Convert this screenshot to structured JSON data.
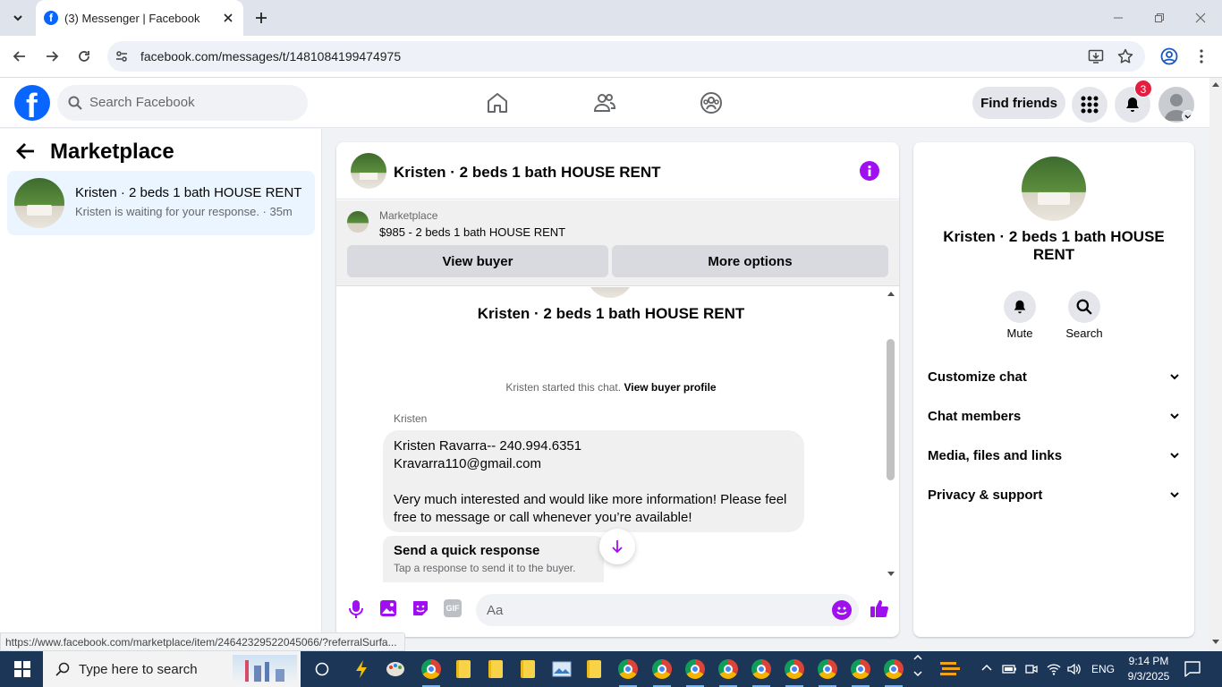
{
  "browser": {
    "tab_title": "(3) Messenger | Facebook",
    "url": "facebook.com/messages/t/1481084199474975"
  },
  "header": {
    "search_placeholder": "Search Facebook",
    "find_friends": "Find friends",
    "notification_count": "3",
    "accent": "#0866ff"
  },
  "left": {
    "title": "Marketplace",
    "conversation": {
      "name": "Kristen · 2 beds 1 bath HOUSE RENT",
      "preview": "Kristen is waiting for your response. · 35m"
    }
  },
  "chat": {
    "title": "Kristen · 2 beds 1 bath HOUSE RENT",
    "marketplace_label": "Marketplace",
    "listing": "$985 - 2 beds 1 bath HOUSE RENT",
    "view_buyer": "View buyer",
    "more_options": "More options",
    "intro_name": "Kristen · 2 beds 1 bath HOUSE RENT",
    "started_text": "Kristen started this chat.",
    "view_buyer_profile": "View buyer profile",
    "sender": "Kristen",
    "message": "Kristen Ravarra-- 240.994.6351\nKravarra110@gmail.com\n\nVery much interested and would like more information! Please feel free to message or call whenever you’re available!",
    "quick_title": "Send a quick response",
    "quick_sub": "Tap a response to send it to the buyer.",
    "composer_placeholder": "Aa",
    "gif_label": "GIF"
  },
  "right": {
    "name": "Kristen · 2 beds 1 bath HOUSE RENT",
    "mute": "Mute",
    "search": "Search",
    "sections": [
      "Customize chat",
      "Chat members",
      "Media, files and links",
      "Privacy & support"
    ]
  },
  "status_url": "https://www.facebook.com/marketplace/item/24642329522045066/?referralSurfa...",
  "taskbar": {
    "search_placeholder": "Type here to search",
    "language": "ENG",
    "time": "9:14 PM",
    "date": "9/3/2025"
  }
}
